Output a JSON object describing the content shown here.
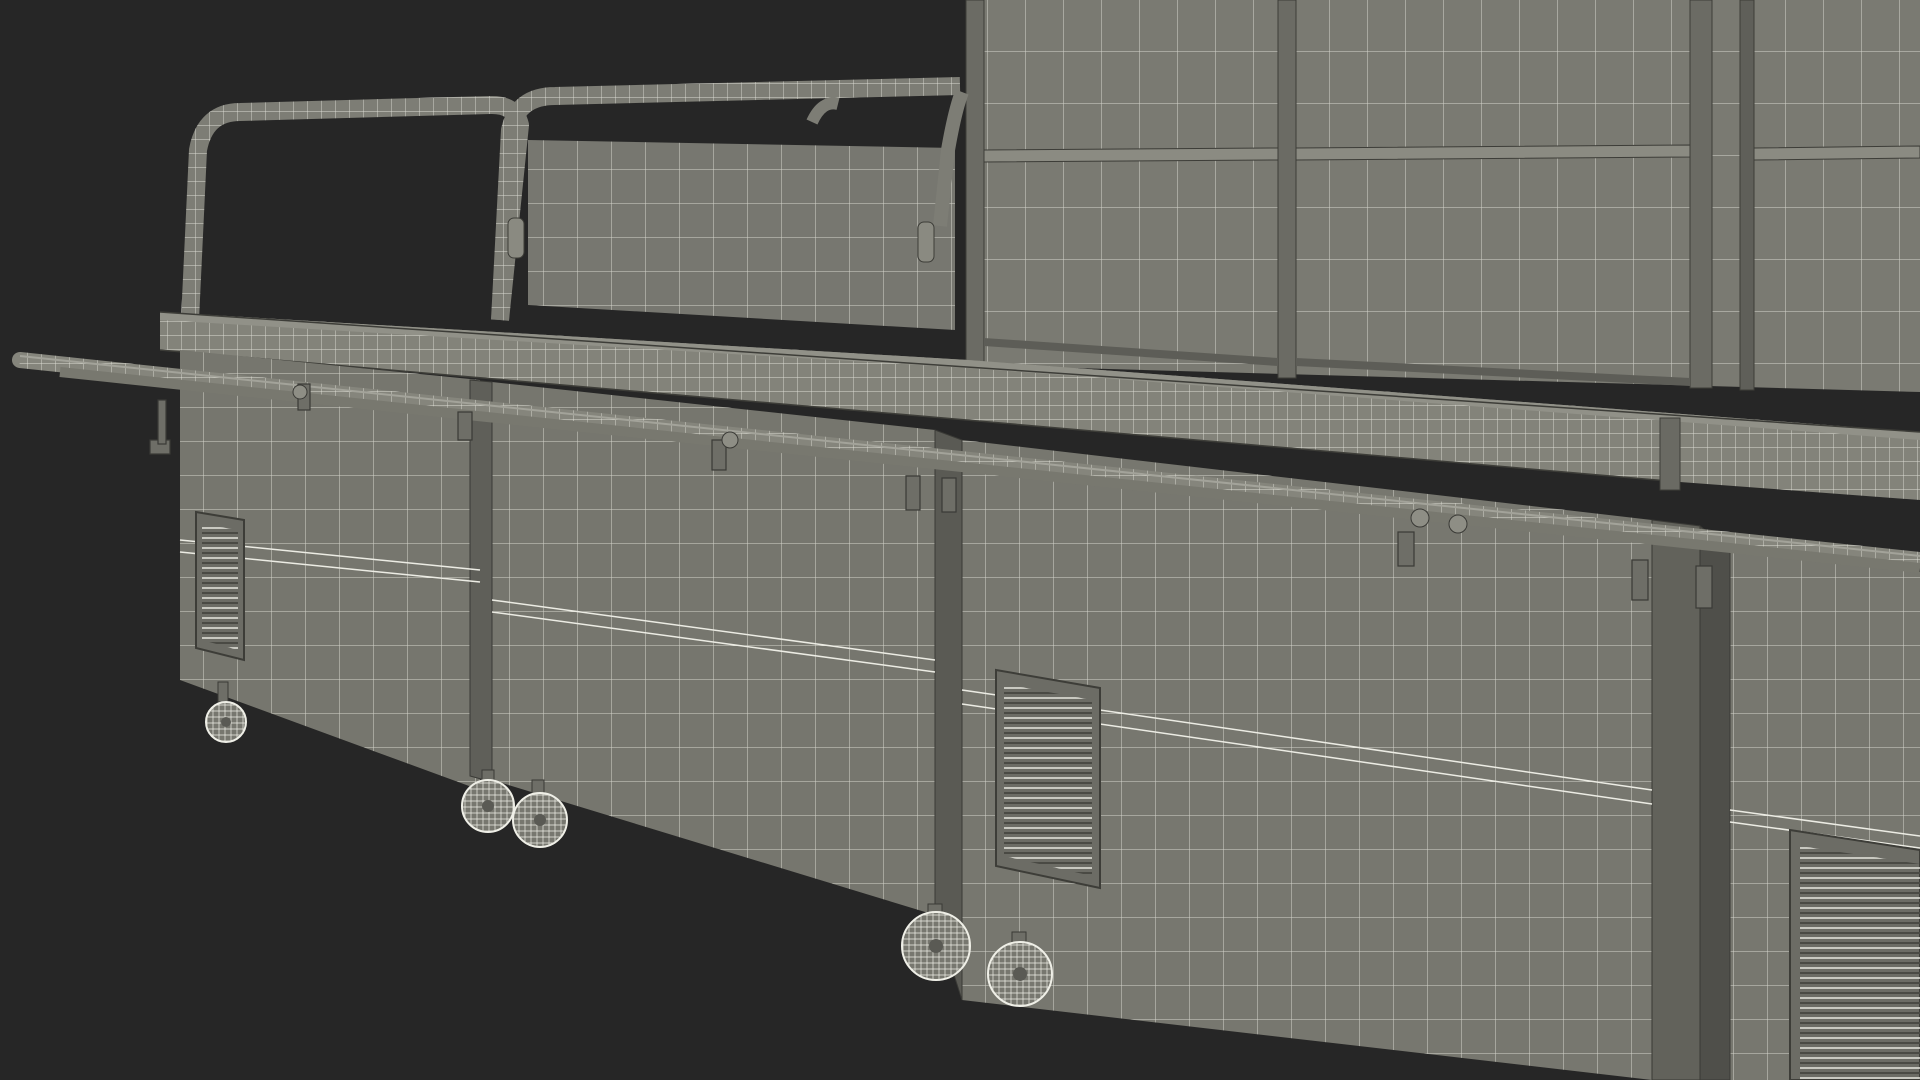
{
  "scene": {
    "subject": "wireframe-food-service-buffet-counter",
    "colors": {
      "background": "#262626",
      "surface": "#787870",
      "surface_dark": "#66665f",
      "surface_light": "#86867d",
      "wire": "#f2f2ea",
      "edge": "#3a3a36"
    }
  }
}
